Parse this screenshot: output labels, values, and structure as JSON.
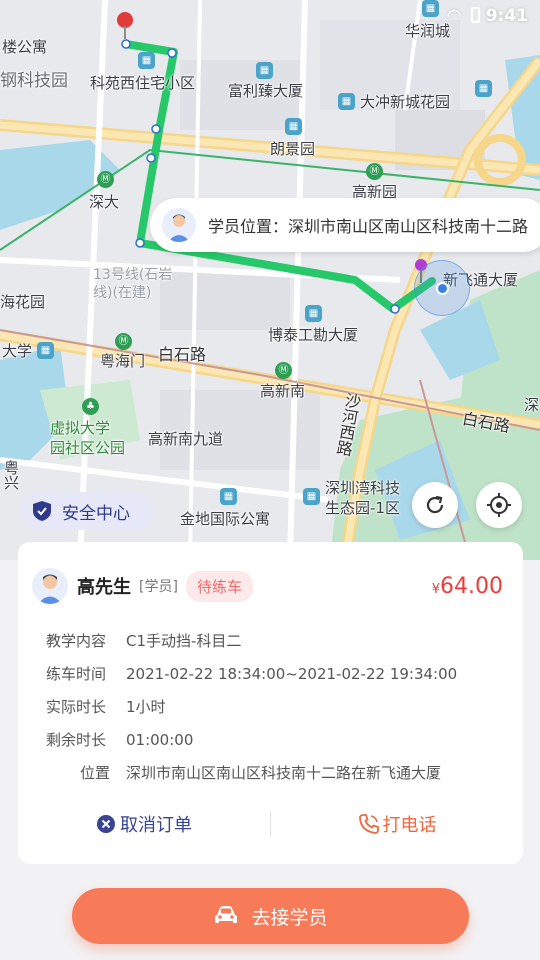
{
  "status_bar": {
    "time": "9:41"
  },
  "map": {
    "labels": {
      "loushi": "楼公寓",
      "ganke": "钢科技园",
      "keyuan": "科苑西住宅小区",
      "huarun": "华润城",
      "fuli": "富利臻大厦",
      "dachong": "大冲新城花园",
      "langjing": "朗景园",
      "shenda": "深大",
      "gaoxinyuan": "高新园",
      "line13": "13号线(石岩\n线)(在建)",
      "xinfeitong": "新飞通大厦",
      "haihuayuan": "海花园",
      "botai": "博泰工勘大厦",
      "daxue": "大学",
      "yuehaimen": "粤海门",
      "baishilu": "白石路",
      "gaoxinnan": "高新南",
      "shahexi": "沙河西路",
      "baishilu2": "白石路",
      "xuni": "虚拟大学\n园社区公园",
      "gaoxinnan9": "高新南九道",
      "shenzhenwan": "深圳湾科技\n生态园-1区",
      "jindi": "金地国际公寓",
      "yuexing": "粤兴",
      "shen_edge": "深"
    },
    "student_location": "学员位置：深圳市南山区南山区科技南十二路",
    "safety_center": "安全中心"
  },
  "order": {
    "name": "高先生",
    "role": "[学员]",
    "status": "待练车",
    "currency": "¥",
    "price": "64.00",
    "rows": [
      {
        "key": "教学内容",
        "value": "C1手动挡-科目二"
      },
      {
        "key": "练车时间",
        "value": "2021-02-22 18:34:00~2021-02-22 19:34:00"
      },
      {
        "key": "实际时长",
        "value": "1小时"
      },
      {
        "key": "剩余时长",
        "value": "01:00:00"
      }
    ],
    "position": {
      "key": "位置",
      "value": "深圳市南山区南山区科技南十二路在新飞通大厦"
    },
    "cancel_label": "取消订单",
    "call_label": "打电话"
  },
  "go_button_label": "去接学员",
  "colors": {
    "route": "#2ecc71",
    "accent": "#f77a59",
    "price": "#ee3c3c",
    "cancel": "#3a4394"
  },
  "icons": [
    "signal-icon",
    "wifi-icon",
    "battery-icon",
    "destination-pin-icon",
    "location-dot-icon",
    "shield-icon",
    "refresh-icon",
    "locate-icon",
    "close-circle-icon",
    "phone-icon",
    "car-icon",
    "avatar-icon"
  ]
}
